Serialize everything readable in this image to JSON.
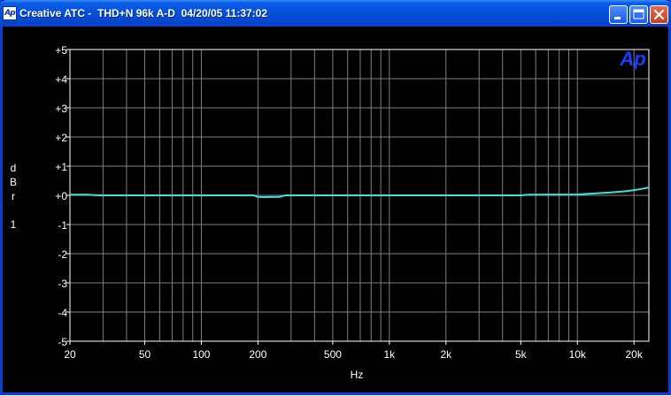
{
  "window": {
    "app_icon_text": "Ap",
    "title": "Creative ATC -  THD+N 96k A-D  04/20/05 11:37:02",
    "minimize_icon": "minimize-icon",
    "maximize_icon": "maximize-icon",
    "close_icon": "close-icon"
  },
  "colors": {
    "background": "#000000",
    "grid": "#7f7f7f",
    "axis_text": "#ffffff",
    "trace": "#40e0e0",
    "logo": "#1a3cff",
    "titlebar": "#0a5ce8"
  },
  "chart_data": {
    "type": "line",
    "title": "",
    "xlabel": "Hz",
    "ylabel_chars": [
      "d",
      "B",
      "r",
      "",
      "1"
    ],
    "logo_text": "Ap",
    "x_scale": "log",
    "xlim": [
      20,
      24000
    ],
    "ylim": [
      -5,
      5
    ],
    "grid": true,
    "x_ticks": [
      {
        "value": 20,
        "label": "20"
      },
      {
        "value": 50,
        "label": "50"
      },
      {
        "value": 100,
        "label": "100"
      },
      {
        "value": 200,
        "label": "200"
      },
      {
        "value": 500,
        "label": "500"
      },
      {
        "value": 1000,
        "label": "1k"
      },
      {
        "value": 2000,
        "label": "2k"
      },
      {
        "value": 5000,
        "label": "5k"
      },
      {
        "value": 10000,
        "label": "10k"
      },
      {
        "value": 20000,
        "label": "20k"
      }
    ],
    "y_ticks": [
      {
        "value": 5,
        "label": "+5"
      },
      {
        "value": 4,
        "label": "+4"
      },
      {
        "value": 3,
        "label": "+3"
      },
      {
        "value": 2,
        "label": "+2"
      },
      {
        "value": 1,
        "label": "+1"
      },
      {
        "value": 0,
        "label": "+0"
      },
      {
        "value": -1,
        "label": "-1"
      },
      {
        "value": -2,
        "label": "-2"
      },
      {
        "value": -3,
        "label": "-3"
      },
      {
        "value": -4,
        "label": "-4"
      },
      {
        "value": -5,
        "label": "-5"
      }
    ],
    "series": [
      {
        "x": [
          20,
          25,
          28,
          30,
          50,
          100,
          190,
          200,
          210,
          260,
          280,
          500,
          1000,
          2000,
          4000,
          5000,
          5500,
          10000,
          12000,
          15000,
          18000,
          20000,
          22000,
          24000
        ],
        "y": [
          0.02,
          0.02,
          0.0,
          0.0,
          0.0,
          0.0,
          0.0,
          -0.05,
          -0.06,
          -0.05,
          0.0,
          0.0,
          0.0,
          0.0,
          0.0,
          0.0,
          0.02,
          0.03,
          0.06,
          0.1,
          0.14,
          0.18,
          0.22,
          0.27
        ]
      }
    ]
  }
}
